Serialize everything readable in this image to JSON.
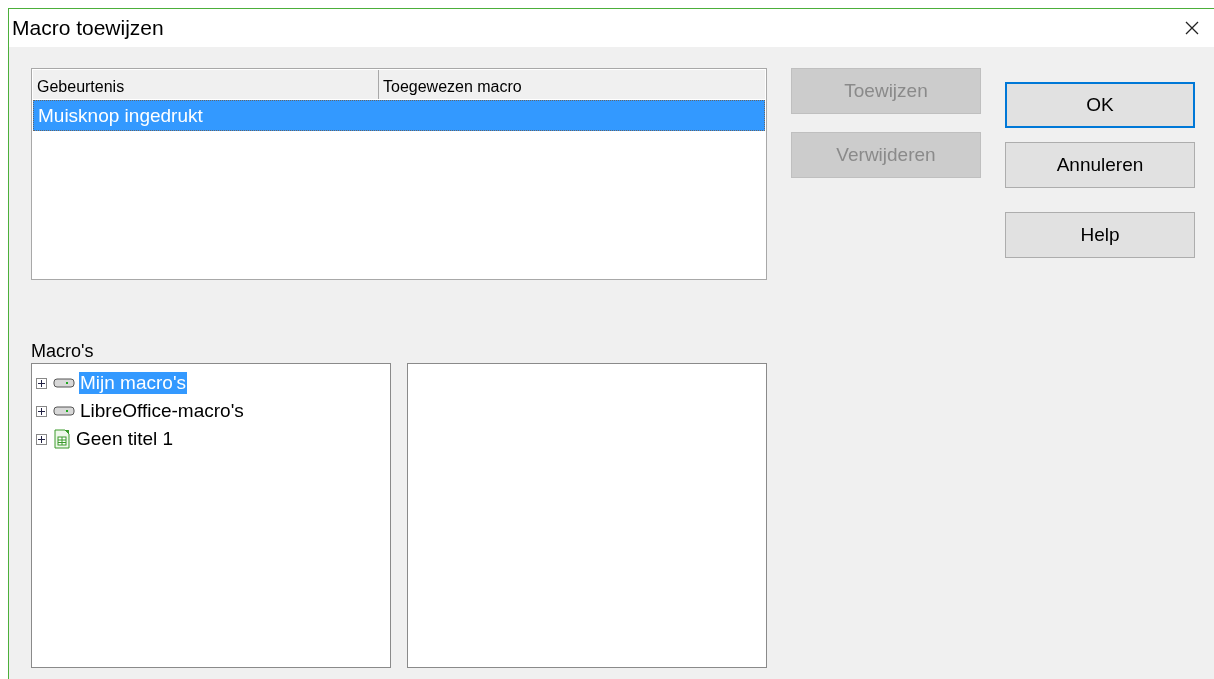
{
  "window": {
    "title": "Macro toewijzen"
  },
  "events_table": {
    "columns": [
      "Gebeurtenis",
      "Toegewezen macro"
    ],
    "rows": [
      {
        "cells": [
          "Muisknop ingedrukt"
        ],
        "selected": true
      }
    ]
  },
  "macros": {
    "label": "Macro's",
    "tree": [
      {
        "kind": "library",
        "label": "Mijn macro's",
        "selected": true,
        "expanded": false
      },
      {
        "kind": "library",
        "label": "LibreOffice-macro's",
        "selected": false,
        "expanded": false
      },
      {
        "kind": "document",
        "label": "Geen titel 1",
        "selected": false,
        "expanded": false
      }
    ]
  },
  "action_buttons": [
    {
      "label": "Toewijzen",
      "disabled": true
    },
    {
      "label": "Verwijderen",
      "disabled": true
    }
  ],
  "dialog_buttons": [
    {
      "label": "OK",
      "default": true
    },
    {
      "label": "Annuleren",
      "default": false
    },
    {
      "label": "Help",
      "default": false
    }
  ]
}
